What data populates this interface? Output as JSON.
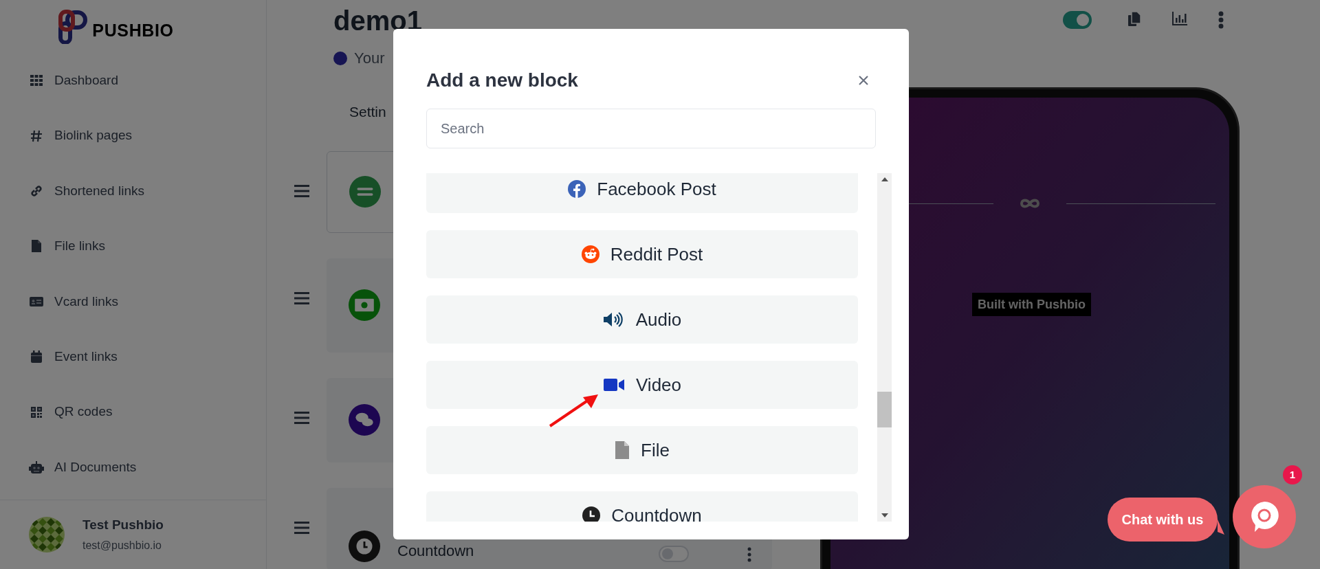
{
  "sidebar": {
    "logo_text": "PUSHBIO",
    "items": [
      {
        "label": "Dashboard"
      },
      {
        "label": "Biolink pages"
      },
      {
        "label": "Shortened links"
      },
      {
        "label": "File links"
      },
      {
        "label": "Vcard links"
      },
      {
        "label": "Event links"
      },
      {
        "label": "QR codes"
      },
      {
        "label": "AI Documents"
      }
    ],
    "user": {
      "name": "Test Pushbio",
      "email": "test@pushbio.io"
    }
  },
  "page": {
    "title": "demo1",
    "status": "Your",
    "tab": "Settin",
    "published": true
  },
  "blocks": [
    {
      "kind": "outlined"
    },
    {
      "kind": "filled"
    },
    {
      "kind": "filled"
    },
    {
      "kind": "filled",
      "label": "Countdown",
      "enabled": false
    }
  ],
  "preview": {
    "badge": "Built with Pushbio"
  },
  "modal": {
    "title": "Add a new block",
    "search": {
      "placeholder": "Search"
    },
    "items": [
      {
        "label": "Facebook Post"
      },
      {
        "label": "Reddit Post"
      },
      {
        "label": "Audio"
      },
      {
        "label": "Video"
      },
      {
        "label": "File"
      },
      {
        "label": "Countdown"
      }
    ]
  },
  "chat": {
    "label": "Chat with us",
    "badge": "1"
  }
}
